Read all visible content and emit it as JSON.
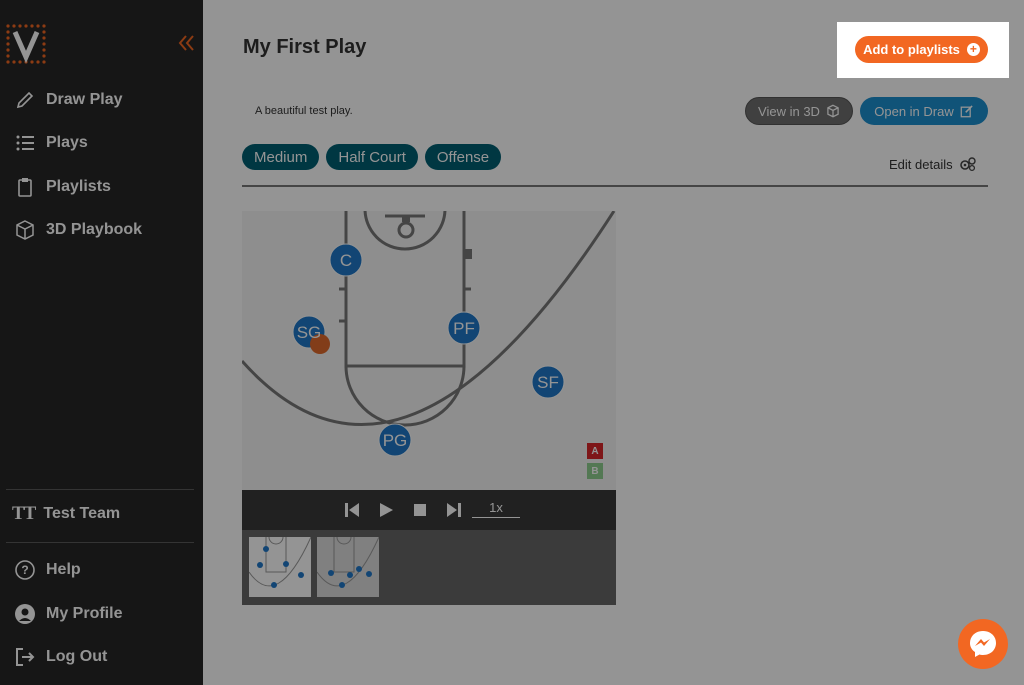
{
  "sidebar": {
    "nav": [
      {
        "label": "Draw Play",
        "icon": "pencil-icon"
      },
      {
        "label": "Plays",
        "icon": "list-icon"
      },
      {
        "label": "Playlists",
        "icon": "clipboard-icon"
      },
      {
        "label": "3D Playbook",
        "icon": "cube-icon"
      }
    ],
    "team": {
      "initials": "TT",
      "name": "Test Team"
    },
    "bottom": [
      {
        "label": "Help",
        "icon": "help-icon"
      },
      {
        "label": "My Profile",
        "icon": "profile-icon"
      },
      {
        "label": "Log Out",
        "icon": "logout-icon"
      }
    ]
  },
  "play": {
    "title": "My First Play",
    "description": "A beautiful test play.",
    "tags": [
      "Medium",
      "Half Court",
      "Offense"
    ],
    "edit_label": "Edit details"
  },
  "buttons": {
    "add_to_playlists": "Add to playlists",
    "view_3d": "View in 3D",
    "open_draw": "Open in Draw"
  },
  "court": {
    "players": [
      "C",
      "SG",
      "PF",
      "SF",
      "PG"
    ],
    "toggle_a": "A",
    "toggle_b": "B"
  },
  "player": {
    "speed": "1x"
  },
  "colors": {
    "accent": "#f26722",
    "tag": "#005f73",
    "player": "#1f78c8",
    "draw_button": "#1d8fcf"
  }
}
